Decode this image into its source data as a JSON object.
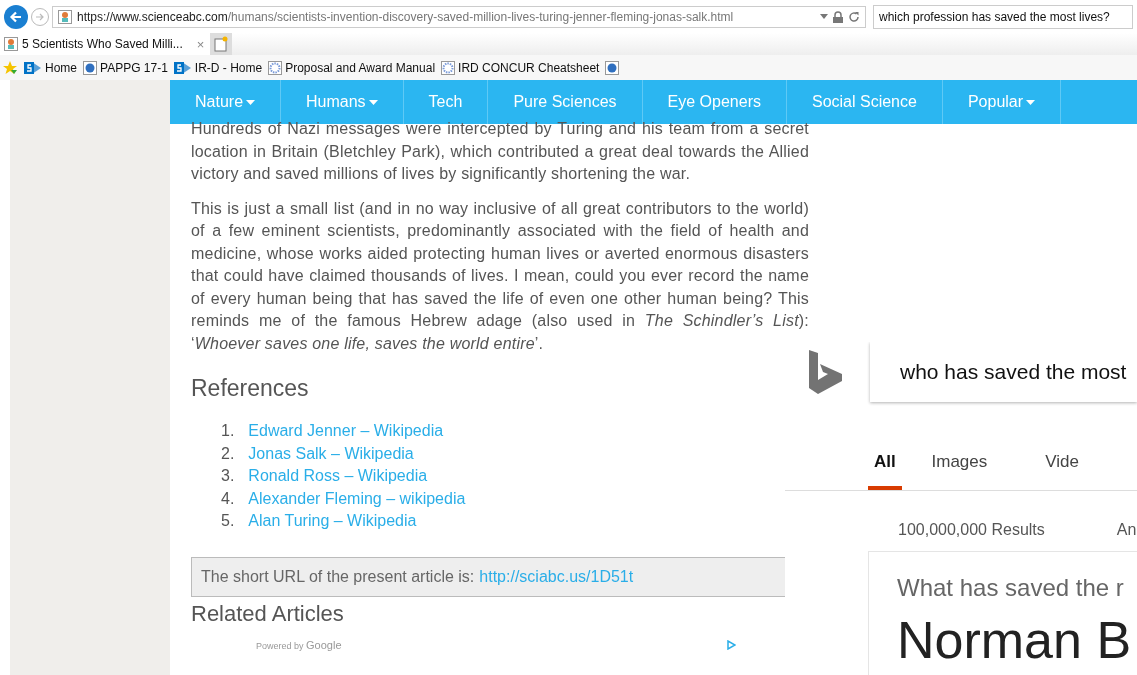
{
  "browser": {
    "url_host": "https://www.scienceabc.com",
    "url_path": "/humans/scientists-invention-discovery-saved-million-lives-turing-jenner-fleming-jonas-salk.html",
    "search": "which profession has saved the most lives?",
    "tabs": [
      {
        "title": "5 Scientists Who Saved Milli...",
        "close": "×",
        "selected": true
      }
    ],
    "favorites": [
      {
        "label": "Home",
        "kind": "sharepoint"
      },
      {
        "label": "PAPPG 17-1",
        "kind": "globe"
      },
      {
        "label": "IR-D - Home",
        "kind": "sharepoint"
      },
      {
        "label": "Proposal and Award Manual",
        "kind": "gear"
      },
      {
        "label": "IRD CONCUR Cheatsheet",
        "kind": "gear"
      },
      {
        "kind": "globe"
      }
    ]
  },
  "nav": [
    {
      "label": "Nature",
      "dropdown": true
    },
    {
      "label": "Humans",
      "dropdown": true
    },
    {
      "label": "Tech",
      "dropdown": false
    },
    {
      "label": "Pure Sciences",
      "dropdown": false
    },
    {
      "label": "Eye Openers",
      "dropdown": false
    },
    {
      "label": "Social Science",
      "dropdown": false
    },
    {
      "label": "Popular",
      "dropdown": true
    }
  ],
  "article": {
    "paragraphs": [
      "Hundreds of Nazi messages were intercepted by Turing and his team from a secret location in Britain (Bletchley Park), which contributed a great deal towards the Allied victory and saved millions of lives by significantly shortening the war.",
      "This is just a small list (and in no way inclusive of all great contributors to the world) of a few eminent scientists, predominantly associated with the field of health and medicine, whose works aided protecting human lives or averted enormous disasters that could have claimed thousands of lives. I mean, could you ever record the name of every human being that has saved the life of even one other human being? This reminds me of the famous Hebrew adage (also used in *The Schindler’s List*): ‘*Whoever saves one life, saves the world entire*’."
    ],
    "references_title": "References",
    "references": [
      {
        "num": "1.",
        "label": "Edward Jenner – Wikipedia"
      },
      {
        "num": "2.",
        "label": "Jonas Salk – Wikipedia"
      },
      {
        "num": "3.",
        "label": "Ronald Ross – Wikipedia"
      },
      {
        "num": "4.",
        "label": "Alexander Fleming – wikipedia"
      },
      {
        "num": "5.",
        "label": "Alan Turing – Wikipedia"
      }
    ],
    "short_url_label": "The short URL of the present article is:",
    "short_url": "http://sciabc.us/1D51t",
    "related_title": "Related Articles",
    "powered_by": "Powered by",
    "google": "Google"
  },
  "bing": {
    "query": "who has saved the most",
    "tabs": [
      {
        "label": "All",
        "selected": true
      },
      {
        "label": "Images",
        "selected": false
      },
      {
        "label": "Vide",
        "selected": false
      }
    ],
    "results": "100,000,000 Results",
    "results_extra": "An",
    "question": "What has saved the r",
    "answer": "Norman B"
  }
}
